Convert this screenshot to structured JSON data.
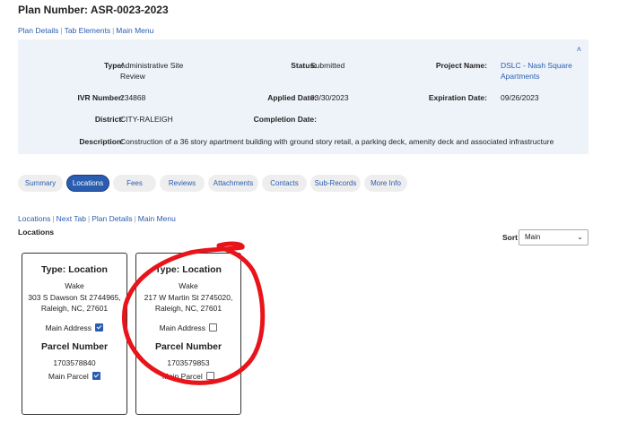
{
  "plan_title": "Plan Number: ASR-0023-2023",
  "top_links": [
    "Plan Details",
    "Tab Elements",
    "Main Menu"
  ],
  "collapse_glyph": "˄",
  "details": {
    "type_label": "Type:",
    "type_value_1": "Administrative Site",
    "type_value_2": "Review",
    "status_label": "Status:",
    "status_value": "Submitted",
    "project_label": "Project Name:",
    "project_value_1": "DSLC - Nash Square",
    "project_value_2": "Apartments",
    "ivr_label": "IVR Number:",
    "ivr_value": "234868",
    "applied_label": "Applied Date:",
    "applied_value": "03/30/2023",
    "expiration_label": "Expiration Date:",
    "expiration_value": "09/26/2023",
    "district_label": "District:",
    "district_value": "CITY-RALEIGH",
    "completion_label": "Completion Date:",
    "completion_value": "",
    "description_label": "Description:",
    "description_value": "Construction of a 36 story apartment building with ground story retail, a parking deck, amenity deck and associated infrastructure"
  },
  "tabs": [
    "Summary",
    "Locations",
    "Fees",
    "Reviews",
    "Attachments",
    "Contacts",
    "Sub-Records",
    "More Info"
  ],
  "active_tab": "Locations",
  "section_links": [
    "Locations",
    "Next Tab",
    "Plan Details",
    "Main Menu"
  ],
  "section_title": "Locations",
  "sort": {
    "label": "Sort",
    "selected": "Main",
    "chevron": "⌄"
  },
  "locations": [
    {
      "type": "Type: Location",
      "county": "Wake",
      "address_line": "303 S Dawson St 2744965,",
      "city_line": "Raleigh, NC, 27601",
      "main_address_label": "Main Address",
      "main_address_checked": true,
      "parcel_header": "Parcel Number",
      "parcel_number": "1703578840",
      "main_parcel_label": "Main Parcel",
      "main_parcel_checked": true
    },
    {
      "type": "Type: Location",
      "county": "Wake",
      "address_line": "217 W Martin St 2745020,",
      "city_line": "Raleigh, NC, 27601",
      "main_address_label": "Main Address",
      "main_address_checked": false,
      "parcel_header": "Parcel Number",
      "parcel_number": "1703579853",
      "main_parcel_label": "Main Parcel",
      "main_parcel_checked": false
    }
  ],
  "colors": {
    "link": "#2a5db0",
    "panel": "#eef3fa",
    "annotation": "#e8141a"
  }
}
